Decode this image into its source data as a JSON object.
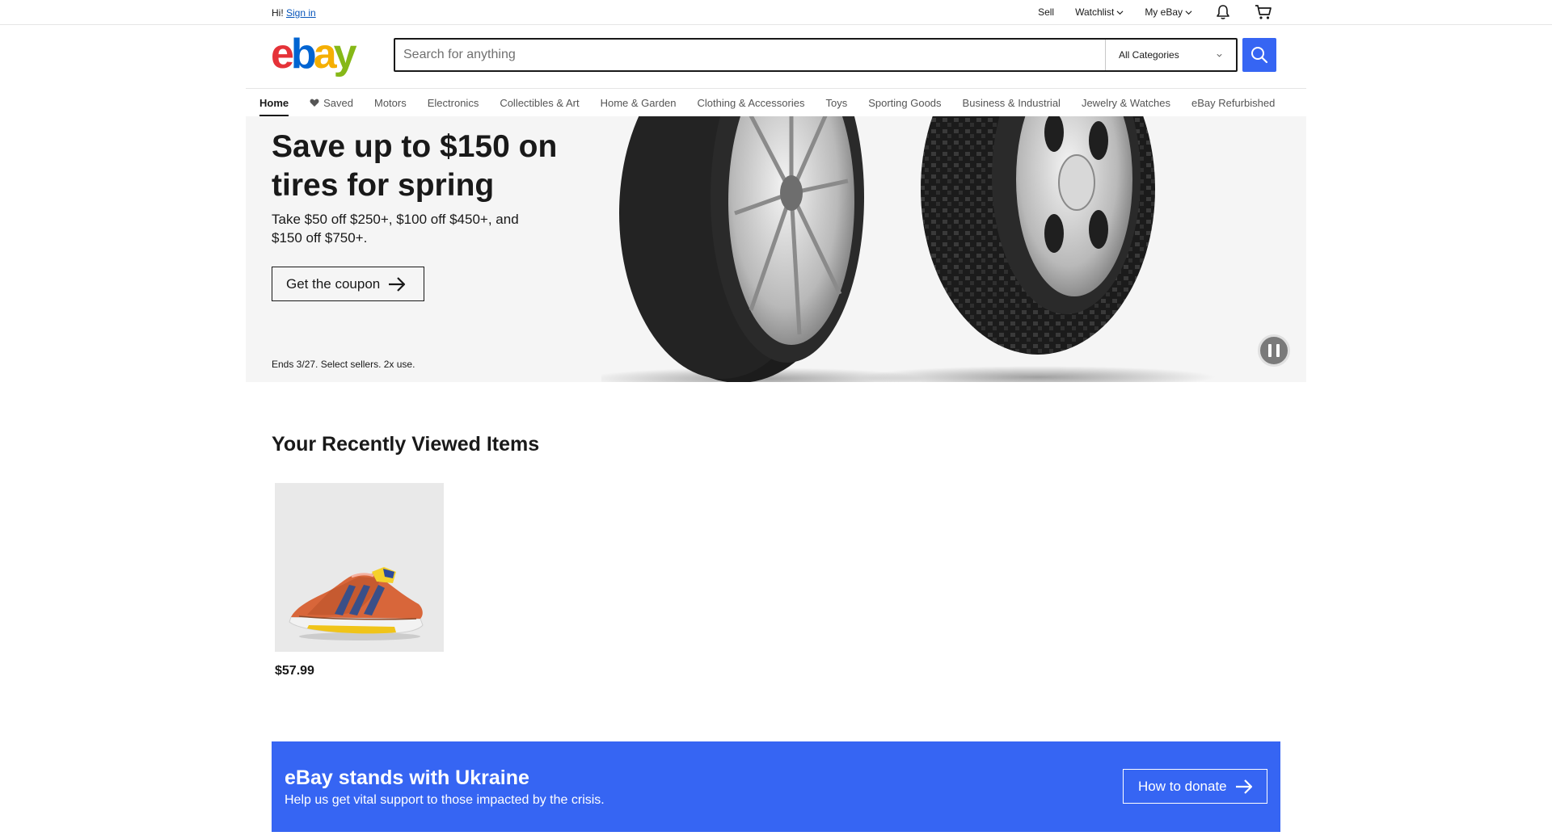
{
  "topbar": {
    "greeting": "Hi!",
    "sign_in": "Sign in",
    "links": {
      "sell": "Sell",
      "watchlist": "Watchlist",
      "my_ebay": "My eBay"
    }
  },
  "header": {
    "logo_text": "ebay",
    "logo_colors": {
      "e": "#e53238",
      "b": "#0064d2",
      "a": "#f5af02",
      "y": "#86b817"
    },
    "search": {
      "placeholder": "Search for anything",
      "value": ""
    },
    "category_select": {
      "selected": "All Categories"
    },
    "search_button_color": "#3665f3"
  },
  "nav": {
    "items": [
      {
        "label": "Home",
        "active": true
      },
      {
        "label": "Saved",
        "icon": "heart-icon"
      },
      {
        "label": "Motors"
      },
      {
        "label": "Electronics"
      },
      {
        "label": "Collectibles & Art"
      },
      {
        "label": "Home & Garden"
      },
      {
        "label": "Clothing & Accessories"
      },
      {
        "label": "Toys"
      },
      {
        "label": "Sporting Goods"
      },
      {
        "label": "Business & Industrial"
      },
      {
        "label": "Jewelry & Watches"
      },
      {
        "label": "eBay Refurbished"
      }
    ]
  },
  "hero": {
    "title": "Save up to $150 on tires for spring",
    "subtitle": "Take $50 off $250+, $100 off $450+, and $150 off $750+.",
    "cta": "Get the coupon",
    "fine_print": "Ends 3/27. Select sellers. 2x use.",
    "background": "#f5f5f5"
  },
  "recently_viewed": {
    "title": "Your Recently Viewed Items",
    "items": [
      {
        "price": "$57.99",
        "image": "sneaker-image"
      }
    ]
  },
  "ukraine": {
    "title": "eBay stands with Ukraine",
    "subtitle": "Help us get vital support to those impacted by the crisis.",
    "cta": "How to donate",
    "background": "#3665f3"
  }
}
